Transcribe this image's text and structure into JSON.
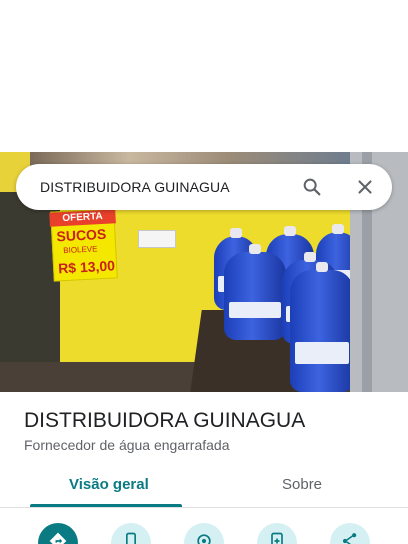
{
  "search": {
    "value": "DISTRIBUIDORA GUINAGUA"
  },
  "place": {
    "name": "DISTRIBUIDORA GUINAGUA",
    "category": "Fornecedor de água engarrafada"
  },
  "tabs": [
    {
      "label": "Visão geral",
      "active": true
    },
    {
      "label": "Sobre",
      "active": false
    }
  ],
  "photo_sign": {
    "banner": "OFERTA",
    "line1": "SUCOS",
    "line2": "BIOLEVE",
    "line3": "R$ 13,00"
  },
  "action_icons": [
    "directions-icon",
    "phone-icon",
    "location-icon",
    "share-file-icon",
    "share-icon"
  ],
  "colors": {
    "accent": "#0b7b83",
    "accent_light": "#d5f0f2"
  }
}
